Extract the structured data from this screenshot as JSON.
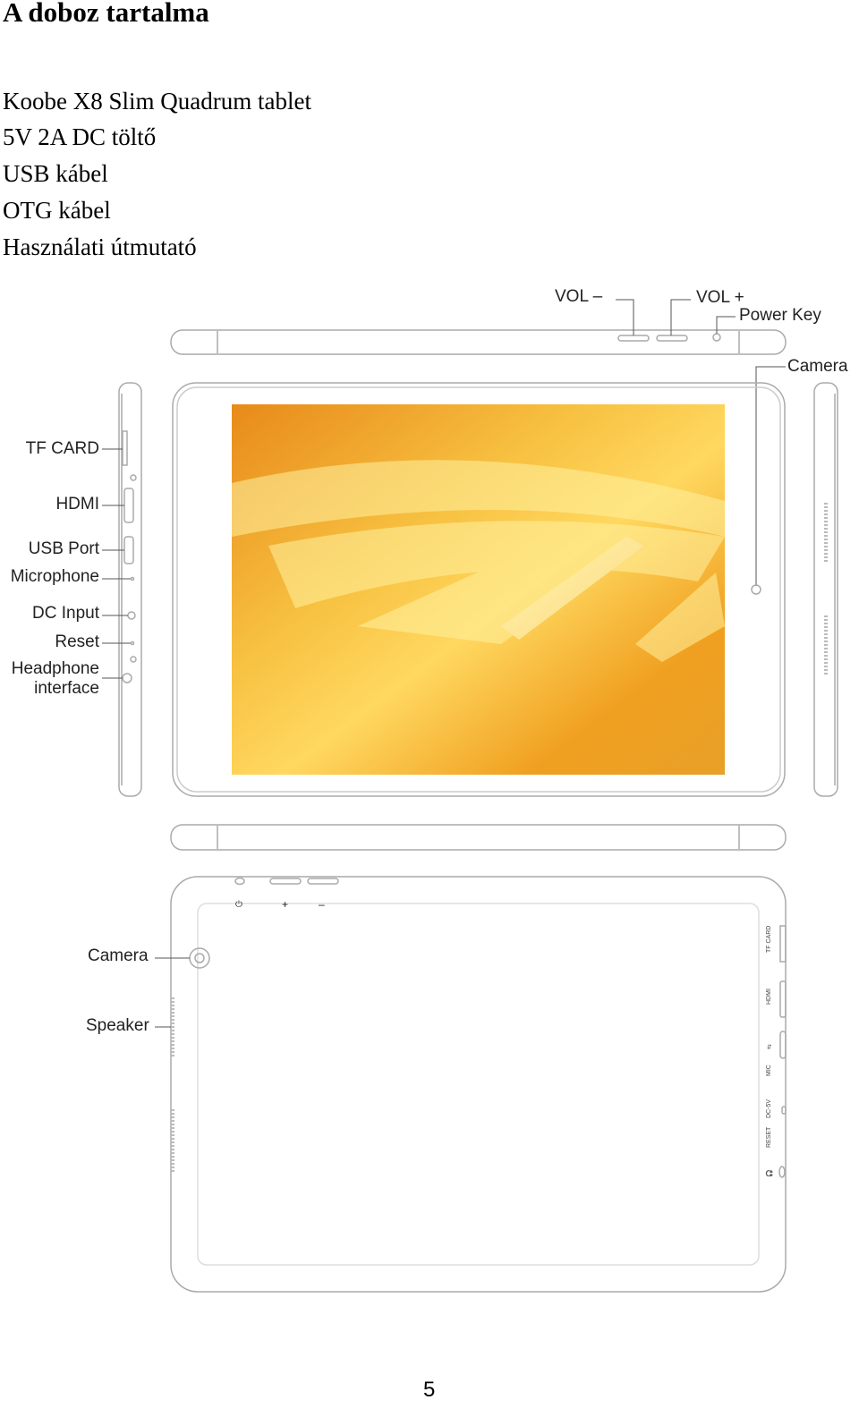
{
  "heading": "A doboz tartalma",
  "contents": [
    "Koobe X8 Slim Quadrum tablet",
    "5V 2A DC töltő",
    "USB kábel",
    "OTG kábel",
    "Használati útmutató"
  ],
  "diagram_labels": {
    "vol_minus": "VOL –",
    "vol_plus": "VOL +",
    "power_key": "Power Key",
    "camera_front": "Camera",
    "tf_card": "TF CARD",
    "hdmi": "HDMI",
    "usb_port": "USB Port",
    "microphone": "Microphone",
    "dc_input": "DC Input",
    "reset": "Reset",
    "headphone": "Headphone",
    "interface": "interface",
    "camera_back": "Camera",
    "speaker": "Speaker"
  },
  "back_symbols": {
    "power": "⏻",
    "plus": "+",
    "minus": "–"
  },
  "side_port_labels": [
    "TF CARD",
    "HDMI",
    "⇆",
    "MIC",
    "DC-5V",
    "RESET",
    "🎧"
  ],
  "page_number": "5",
  "colors": {
    "screen_light": "#ffe070",
    "screen_dark": "#e07a10",
    "outline": "#aaaaaa"
  }
}
